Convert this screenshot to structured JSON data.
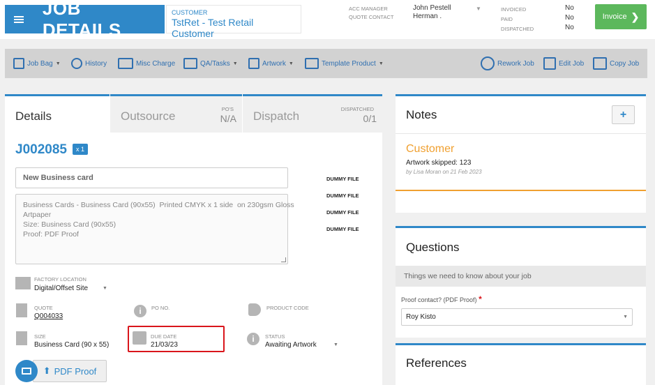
{
  "header": {
    "title": "JOB DETAILS",
    "customer_label": "CUSTOMER",
    "customer_name": "TstRet - Test Retail Customer",
    "acc_manager_label": "ACC MANAGER",
    "quote_contact_label": "QUOTE CONTACT",
    "acc_manager": "John Pestell",
    "quote_contact": "Herman .",
    "invoiced_label": "INVOICED",
    "paid_label": "PAID",
    "dispatched_label": "DISPATCHED",
    "invoiced": "No",
    "paid": "No",
    "dispatched": "No",
    "invoice_button": "Invoice"
  },
  "toolbar": {
    "job_bag": "Job Bag",
    "history": "History",
    "misc_charge": "Misc Charge",
    "qa_tasks": "QA/Tasks",
    "artwork": "Artwork",
    "template_product": "Template Product",
    "rework_job": "Rework Job",
    "edit_job": "Edit Job",
    "copy_job": "Copy Job"
  },
  "tabs": {
    "details": "Details",
    "outsource": "Outsource",
    "pos_label": "PO'S",
    "pos_value": "N/A",
    "dispatch": "Dispatch",
    "dispatched_label": "DISPATCHED",
    "dispatched_value": "0/1"
  },
  "job": {
    "id": "J002085",
    "qty_badge": "x 1",
    "name": "New Business card",
    "description": [
      "Business Cards - Business Card (90x55)  Printed CMYK x 1 side  on 230gsm Gloss",
      "Artpaper",
      "",
      "Size: Business Card (90x55)",
      "Proof: PDF Proof"
    ],
    "dummy_files": [
      "DUMMY FILE",
      "DUMMY FILE",
      "DUMMY FILE",
      "DUMMY FILE"
    ],
    "factory_location_label": "FACTORY LOCATION",
    "factory_location": "Digital/Offset Site",
    "quote_label": "QUOTE",
    "quote": "Q004033",
    "po_label": "PO NO.",
    "product_code_label": "PRODUCT CODE",
    "size_label": "SIZE",
    "size": "Business Card (90 x 55)",
    "due_date_label": "DUE DATE",
    "due_date": "21/03/23",
    "status_label": "STATUS",
    "status": "Awaiting Artwork",
    "proof_button": "PDF Proof"
  },
  "notes": {
    "title": "Notes",
    "add": "+",
    "customer": "Customer",
    "body": "Artwork skipped: 123",
    "meta": "by Lisa Moran on 21 Feb 2023"
  },
  "questions": {
    "title": "Questions",
    "subtitle": "Things we need to know about your job",
    "proof_contact_label": "Proof contact? (PDF Proof)",
    "required": "*",
    "proof_contact": "Roy Kisto"
  },
  "references": {
    "title": "References"
  },
  "colors": {
    "primary": "#2f88c8",
    "success": "#5cb85c",
    "accent": "#f0a030",
    "highlight": "#d9151b"
  }
}
